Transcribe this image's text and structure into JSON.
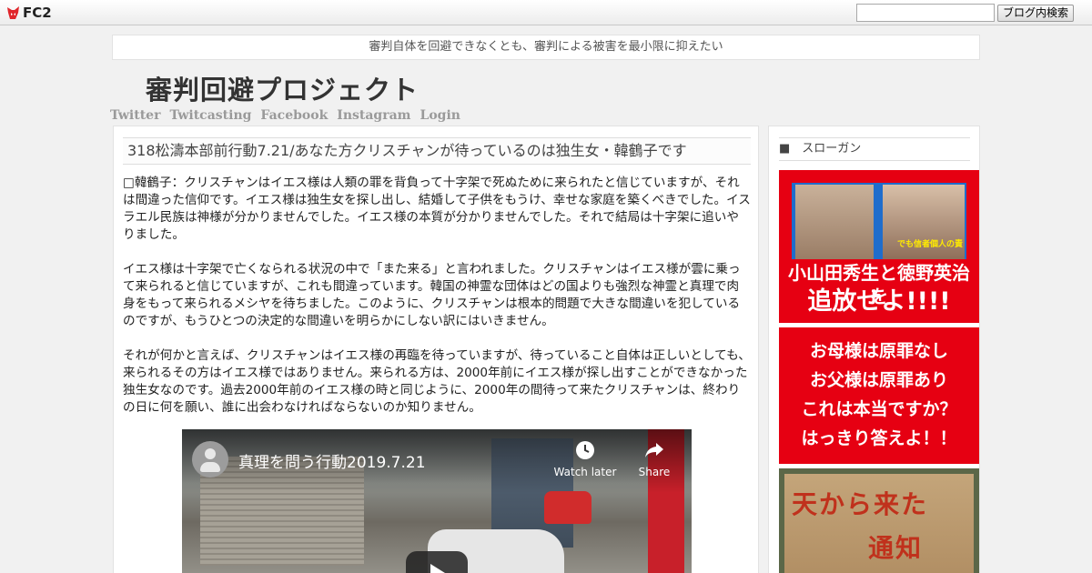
{
  "fc2": {
    "logo_text": "FC2",
    "search_placeholder": "",
    "search_button": "ブログ内検索"
  },
  "tagline": "審判自体を回避できなくとも、審判による被害を最小限に抑えたい",
  "site_title": "審判回避プロジェクト",
  "nav": [
    "Twitter",
    "Twitcasting",
    "Facebook",
    "Instagram",
    "Login"
  ],
  "post": {
    "title": "318松濤本部前行動7.21/あなた方クリスチャンが待っているのは独生女・韓鶴子です",
    "paragraphs": [
      "□韓鶴子：クリスチャンはイエス様は人類の罪を背負って十字架で死ぬために来られたと信じていますが、それは間違った信仰です。イエス様は独生女を探し出し、結婚して子供をもうけ、幸せな家庭を築くべきでした。イスラエル民族は神様が分かりませんでした。イエス様の本質が分かりませんでした。それで結局は十字架に追いやりました。",
      "イエス様は十字架で亡くなられる状況の中で「また来る」と言われました。クリスチャンはイエス様が雲に乗って来られると信じていますが、これも間違っています。韓国の神霊な団体はどの国よりも強烈な神霊と真理で肉身をもって来られるメシヤを待ちました。このように、クリスチャンは根本的問題で大きな間違いを犯しているのですが、もうひとつの決定的な間違いを明らかにしない訳にはいきません。",
      "それが何かと言えば、クリスチャンはイエス様の再臨を待っていますが、待っていること自体は正しいとしても、来られるその方はイエス様ではありません。来られる方は、2000年前にイエス様が探し出すことができなかった独生女なのです。過去2000年前のイエス様の時と同じように、2000年の間待って来たクリスチャンは、終わりの日に何を願い、誰に出会わなければならないのか知りません。"
    ],
    "video": {
      "title": "真理を問う行動2019.7.21",
      "watch_later": "Watch later",
      "share": "Share"
    }
  },
  "sidebar": {
    "title": "■　スローガン",
    "banner1": {
      "caption": "でも信者個人の責",
      "line1": "小山田秀生と徳野英治を",
      "line2": "追放せよ!!!!"
    },
    "banner2": {
      "lines": [
        "お母様は原罪なし",
        "お父様は原罪あり",
        "これは本当ですか？",
        "はっきり答えよ！！"
      ]
    },
    "banner3": {
      "line1": "天から来た",
      "line2": "通知"
    }
  }
}
